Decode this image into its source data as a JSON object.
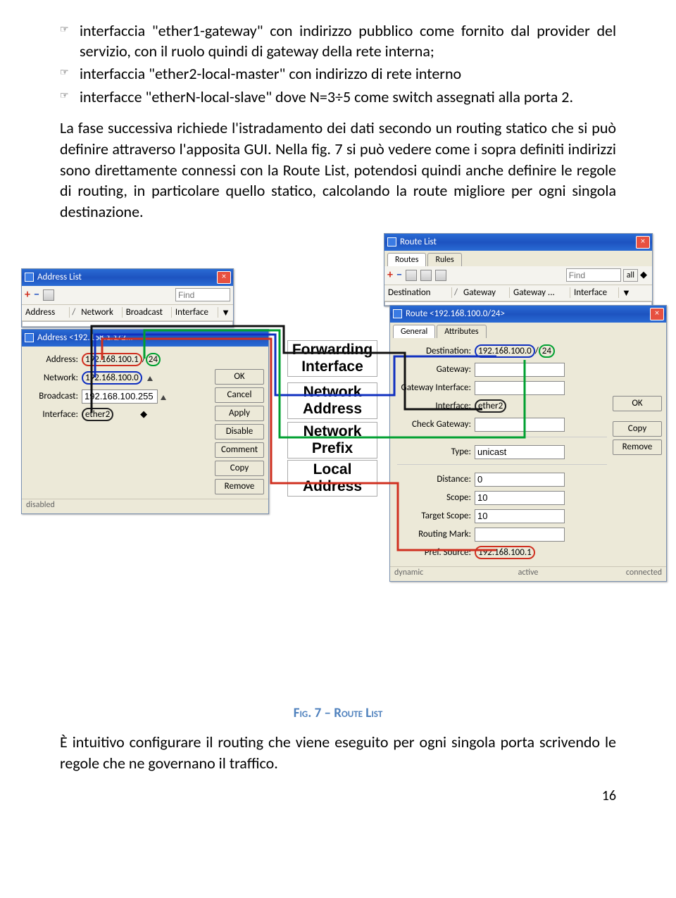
{
  "bullets": [
    {
      "text": "interfaccia \"ether1-gateway\"  con indirizzo pubblico come fornito dal provider del servizio, con il ruolo quindi di gateway della rete interna;"
    },
    {
      "text": "interfaccia \"ether2-local-master\" con indirizzo di rete interno"
    },
    {
      "text": "interfacce \"etherN-local-slave\" dove N=3÷5 come switch assegnati alla porta 2."
    }
  ],
  "para1": "La fase successiva richiede l'istradamento dei dati secondo un routing statico che si può definire attraverso l'apposita GUI. Nella fig. 7 si può vedere come i sopra definiti indirizzi sono direttamente connessi con la Route List, potendosi quindi anche definire le regole di routing, in particolare quello statico, calcolando la route migliore per ogni singola destinazione.",
  "addr_list": {
    "title": "Address List",
    "find": "Find",
    "headers": [
      "Address",
      "Network",
      "Broadcast",
      "Interface"
    ],
    "sort_indicator": "/"
  },
  "addr_dlg": {
    "title": "Address <192.168.1.1/2...",
    "address": "Address:",
    "address_val": "192.168.100.1",
    "address_pfx": "24",
    "network": "Network:",
    "network_val": "192.168.100.0",
    "broadcast": "Broadcast:",
    "broadcast_val": "192.168.100.255",
    "interface": "Interface:",
    "interface_val": "ether2",
    "buttons": [
      "OK",
      "Cancel",
      "Apply",
      "Disable",
      "Comment",
      "Copy",
      "Remove"
    ],
    "status": "disabled"
  },
  "route_list": {
    "title": "Route List",
    "tabs": [
      "Routes",
      "Rules"
    ],
    "find": "Find",
    "all": "all",
    "headers": [
      "Destination",
      "Gateway",
      "Gateway ...",
      "Interface"
    ]
  },
  "route_dlg": {
    "title": "Route <192.168.100.0/24>",
    "tabs": [
      "General",
      "Attributes"
    ],
    "destination": "Destination:",
    "destination_val": "192.168.100.0",
    "destination_pfx": "24",
    "gateway": "Gateway:",
    "gateway_interface": "Gateway Interface:",
    "interface": "Interface:",
    "interface_val": "ether2",
    "check_gateway": "Check Gateway:",
    "type": "Type:",
    "type_val": "unicast",
    "distance": "Distance:",
    "distance_val": "0",
    "scope": "Scope:",
    "scope_val": "10",
    "target_scope": "Target Scope:",
    "target_scope_val": "10",
    "routing_mark": "Routing Mark:",
    "pref_source": "Pref. Source:",
    "pref_source_val": "192.168.100.1",
    "buttons": [
      "OK",
      "Copy",
      "Remove"
    ],
    "status": [
      "dynamic",
      "active",
      "connected"
    ]
  },
  "annotations": {
    "fi": "Forwarding Interface",
    "na": "Network Address",
    "np": "Network Prefix",
    "la": "Local Address"
  },
  "caption": "Fig. 7 – Route List",
  "para2": "È intuitivo configurare il routing che viene eseguito per ogni singola porta scrivendo le regole che ne governano il traffico.",
  "pagenum": "16"
}
